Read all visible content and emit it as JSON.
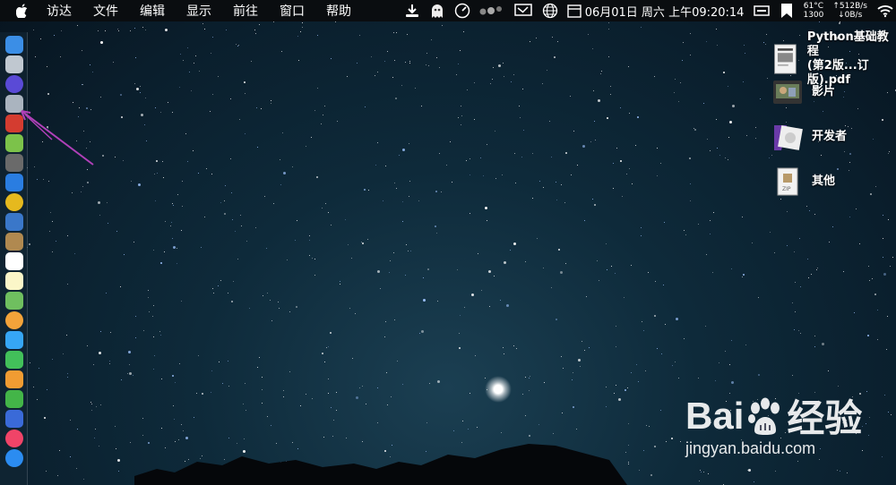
{
  "menubar": {
    "items": [
      "访达",
      "文件",
      "编辑",
      "显示",
      "前往",
      "窗口",
      "帮助"
    ],
    "clock": "06月01日 周六 上午09:20:14",
    "temp_line1": "61°C",
    "temp_line2": "1300",
    "net_up": "↑512B/s",
    "net_down": "↓0B/s"
  },
  "desktop_items": [
    {
      "label_line1": "Python基础教程",
      "label_line2": "(第2版...订版).pdf",
      "icon": "pdf-document-icon"
    },
    {
      "label_line1": "影片",
      "label_line2": "",
      "icon": "movie-folder-icon"
    },
    {
      "label_line1": "开发者",
      "label_line2": "",
      "icon": "developer-folder-icon"
    },
    {
      "label_line1": "其他",
      "label_line2": "",
      "icon": "zip-archive-icon"
    }
  ],
  "watermark": {
    "brand_left": "Bai",
    "brand_right": "经验",
    "url": "jingyan.baidu.com"
  },
  "dock": {
    "icons": [
      "finder-icon",
      "launchpad-icon",
      "siri-icon",
      "rocket-icon",
      "swiftpoint-icon",
      "android-icon",
      "calculator-icon",
      "safari-icon",
      "chrome-icon",
      "preview-icon",
      "notebook-icon",
      "calendar-icon",
      "notes-icon",
      "maps-icon",
      "photos-icon",
      "messages-icon",
      "facetime-icon",
      "pages-icon",
      "numbers-icon",
      "keynote-icon",
      "music-icon",
      "app-store-icon"
    ],
    "colors": [
      "#3b8ee6",
      "#c0c8d0",
      "#5a4ad6",
      "#aab4bf",
      "#d43c30",
      "#7cc24a",
      "#6a6a6a",
      "#2a7de1",
      "#e6b91e",
      "#3a77c9",
      "#b08950",
      "#ffffff",
      "#fbf6c8",
      "#6fbf5f",
      "#f3a33a",
      "#36a6f5",
      "#42c05a",
      "#f19c32",
      "#43b548",
      "#3a6ad8",
      "#f04468",
      "#2b8cf1"
    ]
  },
  "colors": {
    "arrow": "#b040b8",
    "menubar_bg": "#0a0d10"
  }
}
